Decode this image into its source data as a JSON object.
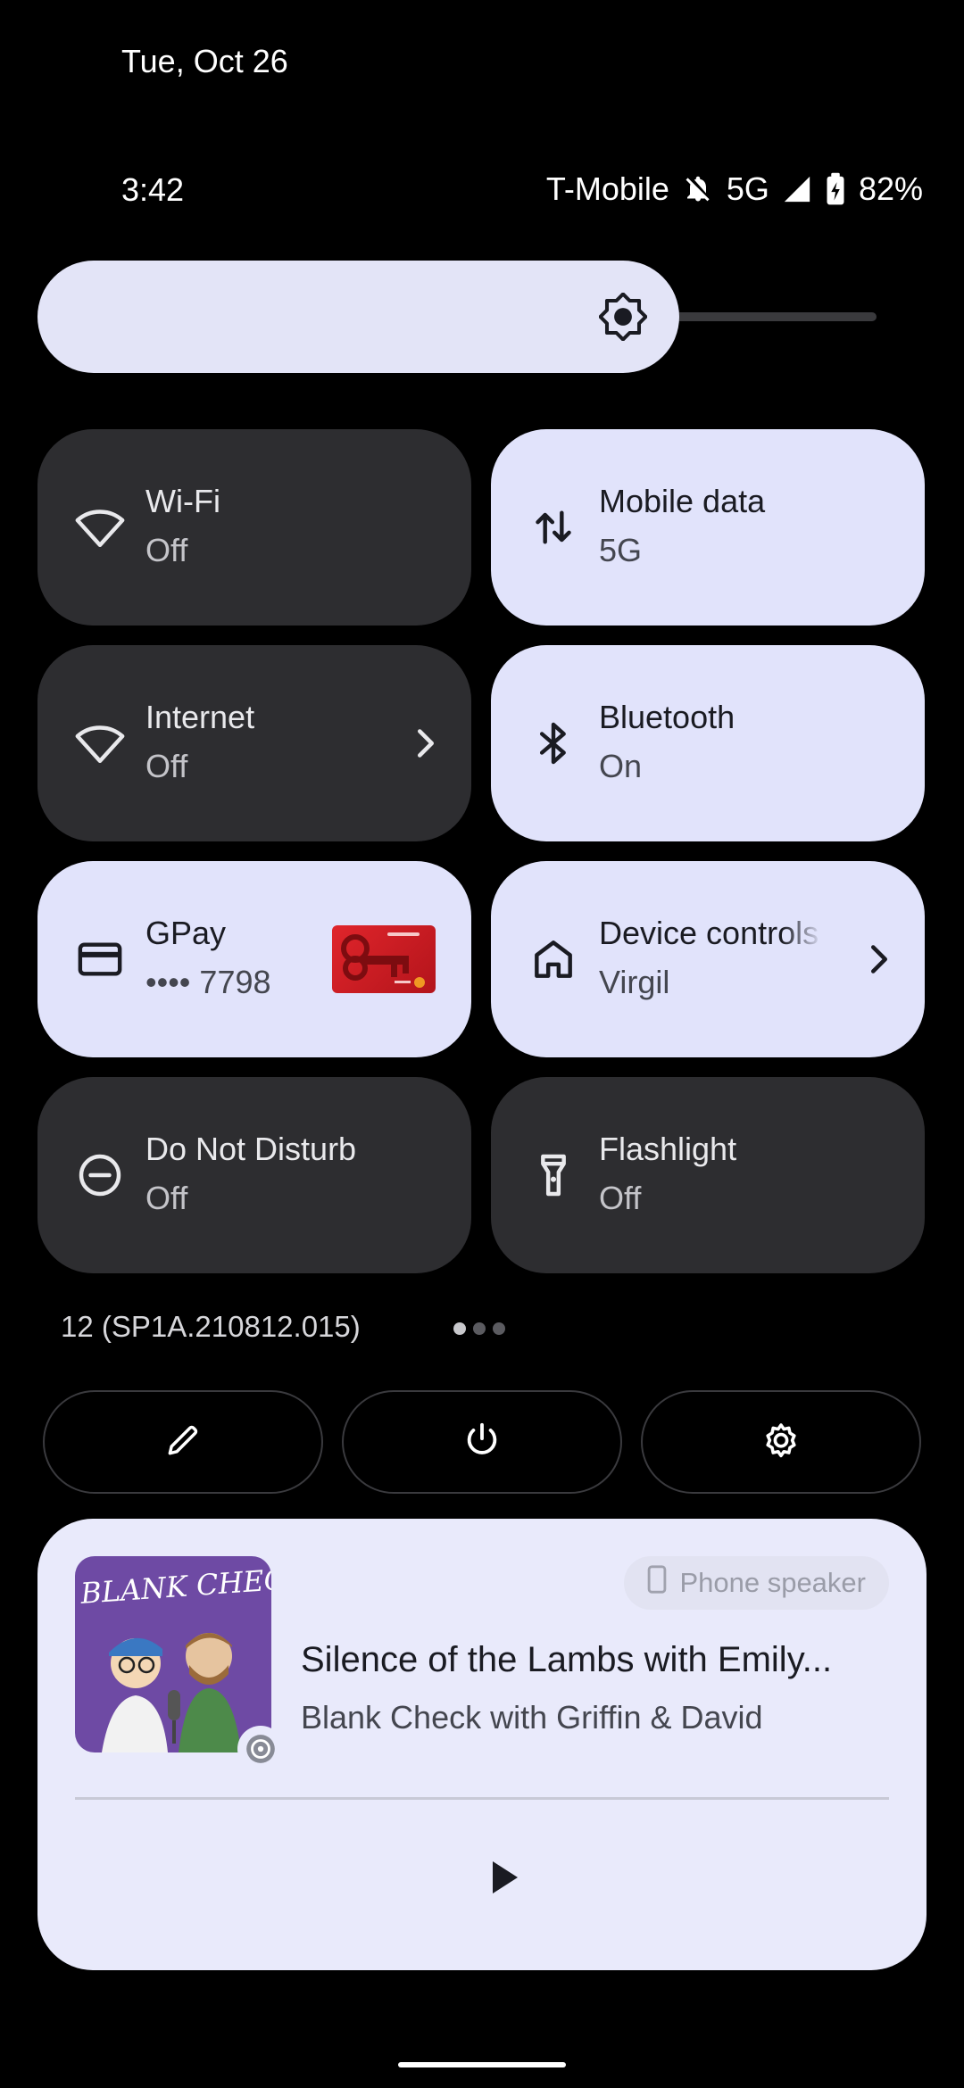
{
  "header": {
    "date": "Tue, Oct 26",
    "time": "3:42",
    "carrier": "T-Mobile",
    "network": "5G",
    "battery": "82%"
  },
  "brightness": {
    "level": 0.68
  },
  "tiles": [
    {
      "title": "Wi-Fi",
      "subtitle": "Off",
      "state": "off",
      "icon": "wifi-icon"
    },
    {
      "title": "Mobile data",
      "subtitle": "5G",
      "state": "on",
      "icon": "mobile-data-icon"
    },
    {
      "title": "Internet",
      "subtitle": "Off",
      "state": "off",
      "icon": "internet-icon"
    },
    {
      "title": "Bluetooth",
      "subtitle": "On",
      "state": "on",
      "icon": "bluetooth-icon"
    },
    {
      "title": "GPay",
      "subtitle": "•••• 7798",
      "state": "on",
      "icon": "credit-card-icon"
    },
    {
      "title": "Device controls",
      "subtitle": "Virgil",
      "state": "on",
      "icon": "home-icon"
    },
    {
      "title": "Do Not Disturb",
      "subtitle": "Off",
      "state": "off",
      "icon": "do-not-disturb-icon"
    },
    {
      "title": "Flashlight",
      "subtitle": "Off",
      "state": "off",
      "icon": "flashlight-icon"
    }
  ],
  "footer": {
    "build": "12 (SP1A.210812.015)",
    "page_count": 3,
    "active_page": 1
  },
  "actions": [
    "edit-icon",
    "power-icon",
    "settings-icon"
  ],
  "media": {
    "output_device": "Phone speaker",
    "title": "Silence of the Lambs with Emily...",
    "artist": "Blank Check with Griffin & David",
    "artwork_text": "BLANK CHECK"
  },
  "colors": {
    "tile_on": "#e1e3fb",
    "tile_off": "#2d2d30",
    "media_card": "#e9eafb"
  }
}
